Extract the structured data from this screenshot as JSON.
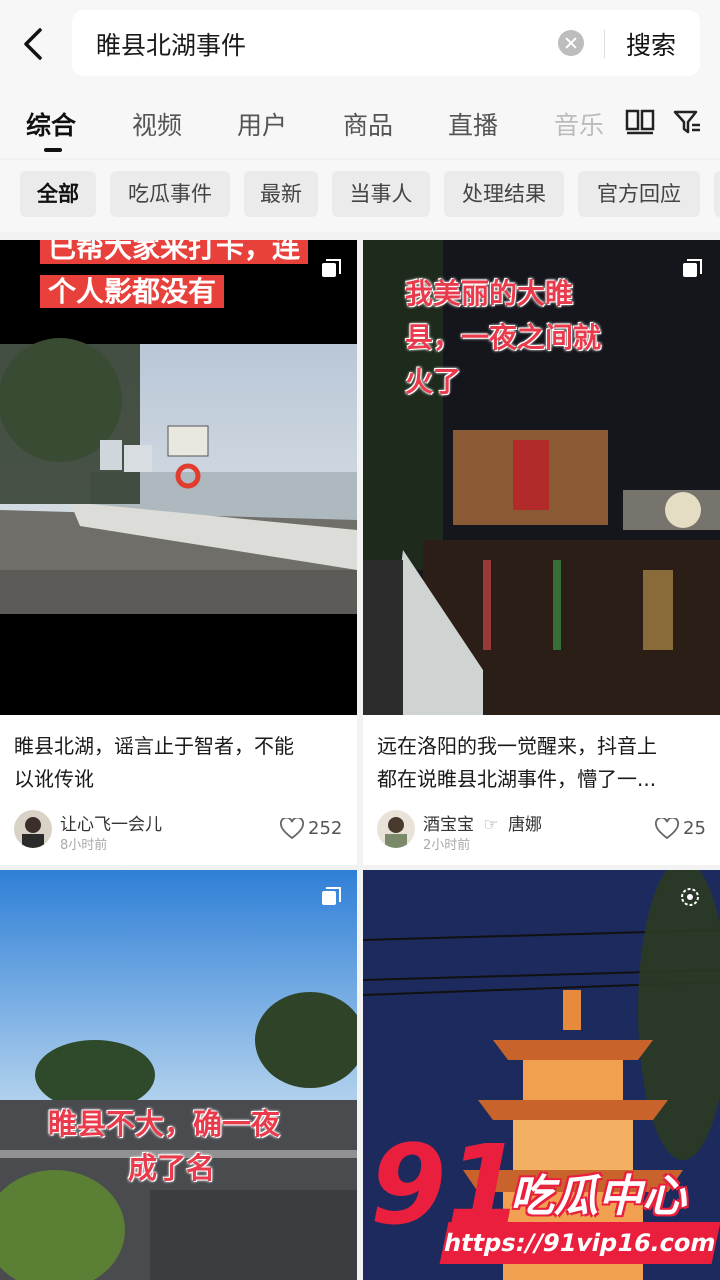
{
  "search": {
    "query": "睢县北湖事件",
    "button_label": "搜索"
  },
  "tabs": [
    {
      "label": "综合",
      "active": true
    },
    {
      "label": "视频"
    },
    {
      "label": "用户"
    },
    {
      "label": "商品"
    },
    {
      "label": "直播"
    },
    {
      "label": "音乐"
    }
  ],
  "filters": [
    "全部",
    "吃瓜事件",
    "最新",
    "当事人",
    "处理结果",
    "官方回应"
  ],
  "cards": [
    {
      "overlay": [
        "已帮大家来打卡，连",
        "个人影都没有"
      ],
      "title_lines": [
        "睢县北湖，谣言止于智者，不能",
        "以讹传讹"
      ],
      "author": "让心飞一会儿",
      "time": "8小时前",
      "likes": "252"
    },
    {
      "overlay": [
        "我美丽的大睢",
        "县，一夜之间就",
        "火了"
      ],
      "title_lines": [
        "远在洛阳的我一觉醒来，抖音上",
        "都在说睢县北湖事件，懵了一..."
      ],
      "author": "酒宝宝",
      "author_sep": "☞",
      "author_extra": "唐娜",
      "time": "2小时前",
      "likes": "25"
    },
    {
      "overlay": [
        "睢县不大，确一夜",
        "成了名"
      ]
    },
    {}
  ],
  "watermark": {
    "logo_number": "91",
    "logo_name": "吃瓜中心",
    "url": "https://91vip16.com"
  },
  "colors": {
    "accent_red": "#e8413c",
    "watermark_red": "#ea1f3d"
  }
}
